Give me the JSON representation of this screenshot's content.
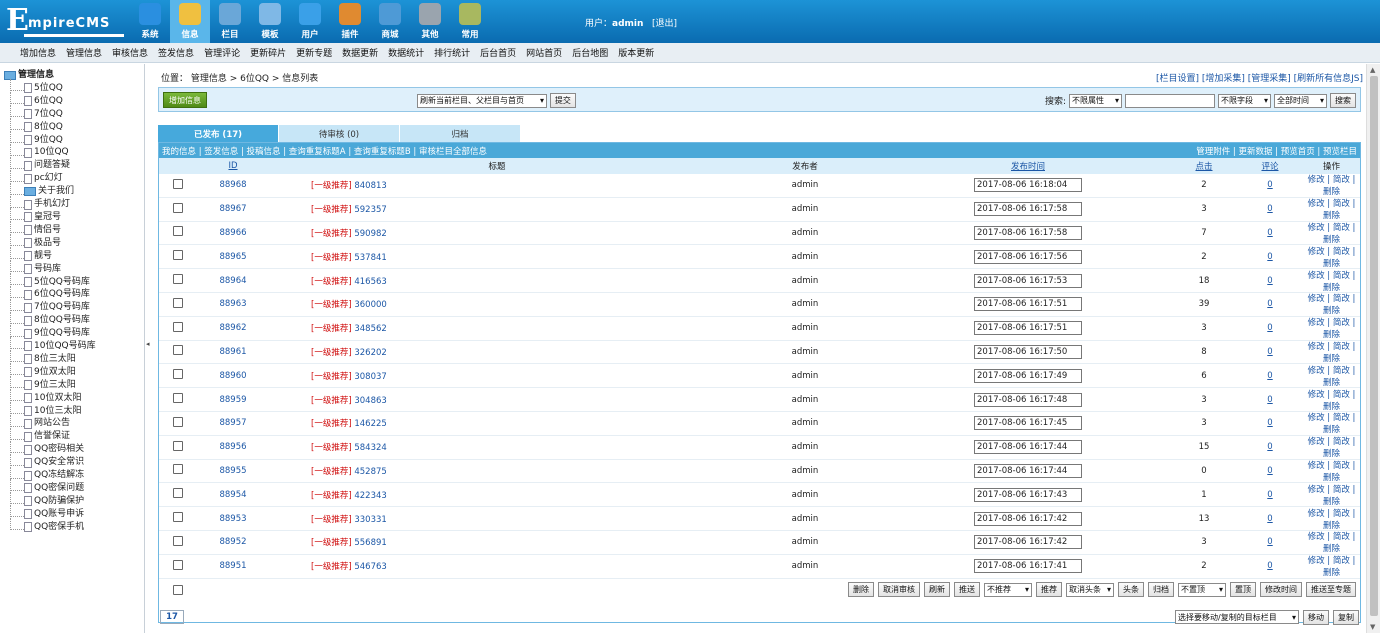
{
  "header": {
    "logo_big": "E",
    "logo_rest": "mpireCMS",
    "nav": [
      {
        "label": "系统",
        "color": "#2a8fe0",
        "on": false
      },
      {
        "label": "信息",
        "color": "#f0c040",
        "on": true
      },
      {
        "label": "栏目",
        "color": "#6aa7d8",
        "on": false
      },
      {
        "label": "模板",
        "color": "#7fb8e6",
        "on": false
      },
      {
        "label": "用户",
        "color": "#3aa0e8",
        "on": false
      },
      {
        "label": "插件",
        "color": "#e08a30",
        "on": false
      },
      {
        "label": "商城",
        "color": "#4e9ad6",
        "on": false
      },
      {
        "label": "其他",
        "color": "#9aa4ae",
        "on": false
      },
      {
        "label": "常用",
        "color": "#a8b860",
        "on": false
      }
    ],
    "user_label": "用户：",
    "user_name": "admin",
    "logout": "[退出]"
  },
  "menu": [
    "增加信息",
    "管理信息",
    "审核信息",
    "签发信息",
    "管理评论",
    "更新碎片",
    "更新专题",
    "数据更新",
    "数据统计",
    "排行统计",
    "后台首页",
    "网站首页",
    "后台地图",
    "版本更新"
  ],
  "sidebar": {
    "root": "管理信息",
    "items": [
      {
        "label": "5位QQ",
        "type": "page"
      },
      {
        "label": "6位QQ",
        "type": "page"
      },
      {
        "label": "7位QQ",
        "type": "page"
      },
      {
        "label": "8位QQ",
        "type": "page"
      },
      {
        "label": "9位QQ",
        "type": "page"
      },
      {
        "label": "10位QQ",
        "type": "page"
      },
      {
        "label": "问题答疑",
        "type": "page"
      },
      {
        "label": "pc幻灯",
        "type": "page"
      },
      {
        "label": "关于我们",
        "type": "folder"
      },
      {
        "label": "手机幻灯",
        "type": "page"
      },
      {
        "label": "皇冠号",
        "type": "page"
      },
      {
        "label": "情侣号",
        "type": "page"
      },
      {
        "label": "极品号",
        "type": "page"
      },
      {
        "label": "靓号",
        "type": "page"
      },
      {
        "label": "号码库",
        "type": "page"
      },
      {
        "label": "5位QQ号码库",
        "type": "page"
      },
      {
        "label": "6位QQ号码库",
        "type": "page"
      },
      {
        "label": "7位QQ号码库",
        "type": "page"
      },
      {
        "label": "8位QQ号码库",
        "type": "page"
      },
      {
        "label": "9位QQ号码库",
        "type": "page"
      },
      {
        "label": "10位QQ号码库",
        "type": "page"
      },
      {
        "label": "8位三太阳",
        "type": "page"
      },
      {
        "label": "9位双太阳",
        "type": "page"
      },
      {
        "label": "9位三太阳",
        "type": "page"
      },
      {
        "label": "10位双太阳",
        "type": "page"
      },
      {
        "label": "10位三太阳",
        "type": "page"
      },
      {
        "label": "网站公告",
        "type": "page"
      },
      {
        "label": "信誉保证",
        "type": "page"
      },
      {
        "label": "QQ密码相关",
        "type": "page"
      },
      {
        "label": "QQ安全常识",
        "type": "page"
      },
      {
        "label": "QQ冻结解冻",
        "type": "page"
      },
      {
        "label": "QQ密保问题",
        "type": "page"
      },
      {
        "label": "QQ防骗保护",
        "type": "page"
      },
      {
        "label": "QQ账号申诉",
        "type": "page"
      },
      {
        "label": "QQ密保手机",
        "type": "page"
      }
    ]
  },
  "main": {
    "crumb": "位置： 管理信息 > 6位QQ > 信息列表",
    "toplinks": "[栏目设置] [增加采集] [管理采集] [刷新所有信息JS]",
    "add_button": "增加信息",
    "refresh_select": "刷新当前栏目、父栏目与首页",
    "submit_button": "提交",
    "search_label": "搜索:",
    "search_attr": "不限属性",
    "search_field": "不限字段",
    "search_time": "全部时间",
    "search_button": "搜索",
    "tabs": [
      {
        "label": "已发布 (17)",
        "on": true
      },
      {
        "label": "待审核 (0)",
        "on": false
      },
      {
        "label": "归档",
        "on": false
      }
    ],
    "box_links_left": "我的信息 | 签发信息 | 投稿信息 | 查询重复标题A | 查询重复标题B | 审核栏目全部信息",
    "box_links_right": "管理附件 | 更新数据 | 预览首页 | 预览栏目",
    "columns": {
      "id": "ID",
      "title": "标题",
      "publisher": "发布者",
      "time": "发布时间",
      "clicks": "点击",
      "comments": "评论",
      "ops": "操作"
    },
    "tag": "[一级推荐]",
    "ops": "修改 | 简改 | 删除",
    "rows": [
      {
        "id": "88968",
        "title": "840813",
        "publisher": "admin",
        "time": "2017-08-06 16:18:04",
        "clicks": "2",
        "comments": "0"
      },
      {
        "id": "88967",
        "title": "592357",
        "publisher": "admin",
        "time": "2017-08-06 16:17:58",
        "clicks": "3",
        "comments": "0"
      },
      {
        "id": "88966",
        "title": "590982",
        "publisher": "admin",
        "time": "2017-08-06 16:17:58",
        "clicks": "7",
        "comments": "0"
      },
      {
        "id": "88965",
        "title": "537841",
        "publisher": "admin",
        "time": "2017-08-06 16:17:56",
        "clicks": "2",
        "comments": "0"
      },
      {
        "id": "88964",
        "title": "416563",
        "publisher": "admin",
        "time": "2017-08-06 16:17:53",
        "clicks": "18",
        "comments": "0"
      },
      {
        "id": "88963",
        "title": "360000",
        "publisher": "admin",
        "time": "2017-08-06 16:17:51",
        "clicks": "39",
        "comments": "0"
      },
      {
        "id": "88962",
        "title": "348562",
        "publisher": "admin",
        "time": "2017-08-06 16:17:51",
        "clicks": "3",
        "comments": "0"
      },
      {
        "id": "88961",
        "title": "326202",
        "publisher": "admin",
        "time": "2017-08-06 16:17:50",
        "clicks": "8",
        "comments": "0"
      },
      {
        "id": "88960",
        "title": "308037",
        "publisher": "admin",
        "time": "2017-08-06 16:17:49",
        "clicks": "6",
        "comments": "0"
      },
      {
        "id": "88959",
        "title": "304863",
        "publisher": "admin",
        "time": "2017-08-06 16:17:48",
        "clicks": "3",
        "comments": "0"
      },
      {
        "id": "88957",
        "title": "146225",
        "publisher": "admin",
        "time": "2017-08-06 16:17:45",
        "clicks": "3",
        "comments": "0"
      },
      {
        "id": "88956",
        "title": "584324",
        "publisher": "admin",
        "time": "2017-08-06 16:17:44",
        "clicks": "15",
        "comments": "0"
      },
      {
        "id": "88955",
        "title": "452875",
        "publisher": "admin",
        "time": "2017-08-06 16:17:44",
        "clicks": "0",
        "comments": "0"
      },
      {
        "id": "88954",
        "title": "422343",
        "publisher": "admin",
        "time": "2017-08-06 16:17:43",
        "clicks": "1",
        "comments": "0"
      },
      {
        "id": "88953",
        "title": "330331",
        "publisher": "admin",
        "time": "2017-08-06 16:17:42",
        "clicks": "13",
        "comments": "0"
      },
      {
        "id": "88952",
        "title": "556891",
        "publisher": "admin",
        "time": "2017-08-06 16:17:42",
        "clicks": "3",
        "comments": "0"
      },
      {
        "id": "88951",
        "title": "546763",
        "publisher": "admin",
        "time": "2017-08-06 16:17:41",
        "clicks": "2",
        "comments": "0"
      }
    ],
    "actions": [
      {
        "label": "删除",
        "kind": "button"
      },
      {
        "label": "取消审核",
        "kind": "button"
      },
      {
        "label": "刷新",
        "kind": "button"
      },
      {
        "label": "推送",
        "kind": "button"
      },
      {
        "label": "不推荐",
        "kind": "select"
      },
      {
        "label": "推荐",
        "kind": "button"
      },
      {
        "label": "取消头条",
        "kind": "select"
      },
      {
        "label": "头条",
        "kind": "button"
      },
      {
        "label": "归档",
        "kind": "button"
      },
      {
        "label": "不置顶",
        "kind": "select"
      },
      {
        "label": "置顶",
        "kind": "button"
      },
      {
        "label": "修改时间",
        "kind": "button"
      },
      {
        "label": "推送至专题",
        "kind": "button"
      }
    ],
    "page_count": "17",
    "move_select": "选择要移动/复制的目标栏目",
    "move_button": "移动",
    "copy_button": "复制"
  }
}
